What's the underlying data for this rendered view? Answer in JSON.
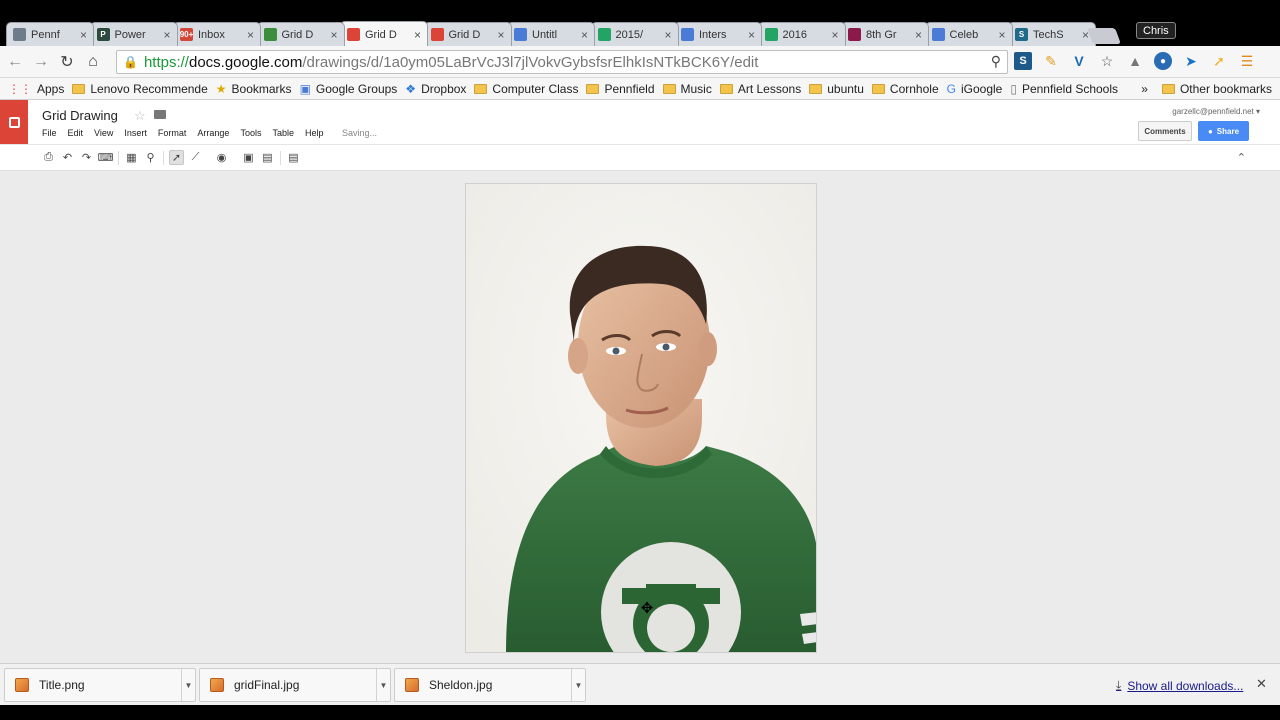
{
  "tabs": [
    {
      "title": "Pennf",
      "color": "#6e7b8b",
      "glyph": ""
    },
    {
      "title": "Power",
      "color": "#2d4a3e",
      "glyph": "P"
    },
    {
      "title": "Inbox",
      "color": "#d44638",
      "glyph": "90+"
    },
    {
      "title": "Grid D",
      "color": "#3c8d3c",
      "glyph": ""
    },
    {
      "title": "Grid D",
      "color": "#db4437",
      "glyph": ""
    },
    {
      "title": "Grid D",
      "color": "#db4437",
      "glyph": ""
    },
    {
      "title": "Untitl",
      "color": "#4a7bd6",
      "glyph": ""
    },
    {
      "title": "2015/",
      "color": "#21a464",
      "glyph": ""
    },
    {
      "title": "Inters",
      "color": "#4a7bd6",
      "glyph": ""
    },
    {
      "title": "2016",
      "color": "#21a464",
      "glyph": ""
    },
    {
      "title": "8th Gr",
      "color": "#8b1a4a",
      "glyph": ""
    },
    {
      "title": "Celeb",
      "color": "#4a7bd6",
      "glyph": ""
    },
    {
      "title": "TechS",
      "color": "#1e6a8a",
      "glyph": "S"
    }
  ],
  "active_tab_index": 4,
  "profile_name": "Chris",
  "url": {
    "scheme": "https://",
    "host": "docs.google.com",
    "path": "/drawings/d/1a0ym05LaBrVcJ3l7jlVokvGybsfsrElhkIsNTkBCK6Y/edit"
  },
  "bookmarks": [
    {
      "label": "Apps",
      "type": "apps"
    },
    {
      "label": "Lenovo Recommende",
      "type": "folder"
    },
    {
      "label": "Bookmarks",
      "type": "star"
    },
    {
      "label": "Google Groups",
      "type": "groups"
    },
    {
      "label": "Dropbox",
      "type": "dropbox"
    },
    {
      "label": "Computer Class",
      "type": "folder"
    },
    {
      "label": "Pennfield",
      "type": "folder"
    },
    {
      "label": "Music",
      "type": "folder"
    },
    {
      "label": "Art Lessons",
      "type": "folder"
    },
    {
      "label": "ubuntu",
      "type": "folder"
    },
    {
      "label": "Cornhole",
      "type": "folder"
    },
    {
      "label": "iGoogle",
      "type": "google"
    },
    {
      "label": "Pennfield Schools",
      "type": "page"
    }
  ],
  "bookmarks_overflow": "»",
  "other_bookmarks": "Other bookmarks",
  "doc": {
    "title": "Grid Drawing",
    "menus": [
      "File",
      "Edit",
      "View",
      "Insert",
      "Format",
      "Arrange",
      "Tools",
      "Table",
      "Help"
    ],
    "status": "Saving...",
    "account": "garzellc@pennfield.net ▾",
    "comments_label": "Comments",
    "share_label": "Share"
  },
  "downloads": [
    {
      "name": "Title.png"
    },
    {
      "name": "gridFinal.jpg"
    },
    {
      "name": "Sheldon.jpg"
    }
  ],
  "show_all_downloads": "Show all downloads..."
}
